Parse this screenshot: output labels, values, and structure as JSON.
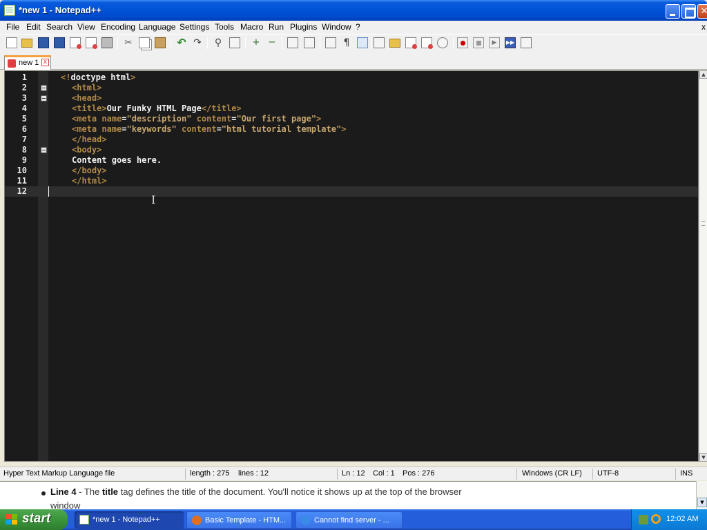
{
  "window": {
    "title": "*new 1 - Notepad++",
    "controls": {
      "minimize_icon": "minimize-icon",
      "maximize_icon": "maximize-icon",
      "close_icon": "close-icon",
      "close_glyph": "✕"
    }
  },
  "menu": {
    "items": [
      "File",
      "Edit",
      "Search",
      "View",
      "Encoding",
      "Language",
      "Settings",
      "Tools",
      "Macro",
      "Run",
      "Plugins",
      "Window",
      "?"
    ],
    "close_glyph": "x"
  },
  "toolbar": {
    "icons": [
      "new-file-icon",
      "open-file-icon",
      "save-icon",
      "save-all-icon",
      "close-icon",
      "close-all-icon",
      "print-icon",
      "cut-icon",
      "copy-icon",
      "paste-icon",
      "undo-icon",
      "redo-icon",
      "find-icon",
      "replace-icon",
      "zoom-in-icon",
      "zoom-out-icon",
      "sync-vertical-icon",
      "sync-horizontal-icon",
      "word-wrap-icon",
      "show-all-chars-icon",
      "indent-guide-icon",
      "user-language-icon",
      "doc-map-icon",
      "function-list-icon",
      "folder-workspace-icon",
      "monitoring-icon",
      "record-macro-icon",
      "stop-macro-icon",
      "play-macro-icon",
      "run-macro-multiple-icon",
      "save-macro-icon"
    ],
    "glyphs": {
      "scissors": "✂",
      "undo": "↶",
      "redo": "↷",
      "find": "⚲",
      "zoom_in": "+",
      "zoom_out": "−",
      "pilcrow": "¶",
      "play": "▶",
      "fast_forward": "▶▶"
    }
  },
  "tabs": [
    {
      "label": "new 1",
      "close_glyph": "x",
      "modified": true
    }
  ],
  "editor": {
    "lines": [
      "1",
      "2",
      "3",
      "4",
      "5",
      "6",
      "7",
      "8",
      "9",
      "10",
      "11",
      "12"
    ],
    "code": {
      "l1_open": "<",
      "l1_mark": "!",
      "l1_rest": "doctype html",
      "l1_close": ">",
      "l2": "<html>",
      "l3": "<head>",
      "l4_open": "<title>",
      "l4_text": "Our Funky HTML Page",
      "l4_close": "</title>",
      "l5_tag": "<meta",
      "l5_attr1": "name",
      "l5_val1": "\"description\"",
      "l5_attr2": "content",
      "l5_val2": "\"Our first page\"",
      "l5_end": ">",
      "l6_tag": "<meta",
      "l6_attr1": "name",
      "l6_val1": "\"keywords\"",
      "l6_attr2": "content",
      "l6_val2": "\"html tutorial template\"",
      "l6_end": ">",
      "l7": "</head>",
      "l8": "<body>",
      "l9": "Content goes here.",
      "l10": "</body>",
      "l11": "</html>",
      "eq": "="
    },
    "text_cursor_glyph": "I"
  },
  "scrollbar": {
    "up_glyph": "▲",
    "down_glyph": "▼"
  },
  "statusbar": {
    "file_type": "Hyper Text Markup Language file",
    "length": "length : 275",
    "lines": "lines : 12",
    "ln": "Ln : 12",
    "col": "Col : 1",
    "pos": "Pos : 276",
    "eol": "Windows (CR LF)",
    "encoding": "UTF-8",
    "mode": "INS"
  },
  "background_page": {
    "line4_prefix": "Line 4",
    "line4_dash": " - The ",
    "line4_keyword": "title",
    "line4_rest": " tag defines the title of the document. You'll notice it shows up at the top of the browser",
    "line4_wrap": "window"
  },
  "taskbar": {
    "start_label": "start",
    "buttons": [
      {
        "label": "*new 1 - Notepad++",
        "icon": "notepadpp-icon",
        "active": true
      },
      {
        "label": "Basic Template - HTM...",
        "icon": "firefox-icon",
        "active": false
      },
      {
        "label": "Cannot find server - ...",
        "icon": "ie-icon",
        "active": false
      }
    ],
    "clock": "12:02 AM"
  },
  "colors": {
    "editor_bg": "#1b1b1b",
    "tag": "#b28a4a",
    "text": "#f2f2f2",
    "current_line": "#2e2e2e",
    "titlebar": "#0052d6",
    "taskbar": "#245edb",
    "start_green": "#3a953a"
  }
}
